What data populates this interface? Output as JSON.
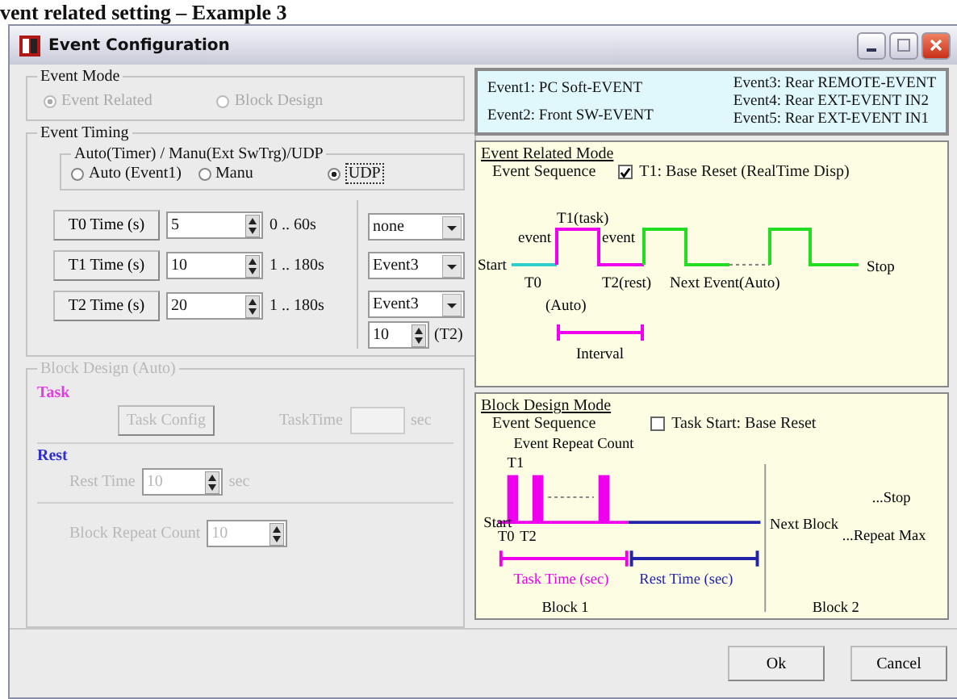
{
  "caption": "vent related setting – Example 3",
  "window": {
    "title": "Event Configuration"
  },
  "event_mode": {
    "label": "Event Mode",
    "options": [
      {
        "label": "Event Related",
        "selected": true,
        "disabled": true
      },
      {
        "label": "Block Design",
        "selected": false,
        "disabled": true
      }
    ]
  },
  "event_timing": {
    "label": "Event Timing",
    "trigger": {
      "label": "Auto(Timer) / Manu(Ext SwTrg)/UDP",
      "options": [
        {
          "label": "Auto (Event1)",
          "selected": false
        },
        {
          "label": "Manu",
          "selected": false
        },
        {
          "label": "UDP",
          "selected": true
        }
      ]
    },
    "times": [
      {
        "button": "T0 Time (s)",
        "value": "5",
        "range": "0 .. 60s",
        "select": "none"
      },
      {
        "button": "T1 Time (s)",
        "value": "10",
        "range": "1 .. 180s",
        "select": "Event3"
      },
      {
        "button": "T2 Time (s)",
        "value": "20",
        "range": "1 .. 180s",
        "select": "Event3"
      }
    ],
    "t2_count": {
      "value": "10",
      "suffix": "(T2)"
    }
  },
  "block_design": {
    "label": "Block Design (Auto)",
    "disabled": true,
    "task_label": "Task",
    "task_config": "Task Config",
    "task_time_label": "TaskTime",
    "task_time_unit": "sec",
    "rest_label": "Rest",
    "rest_time_label": "Rest Time",
    "rest_time_value": "10",
    "rest_time_unit": "sec",
    "repeat_label": "Block Repeat Count",
    "repeat_value": "10"
  },
  "legend": {
    "left": [
      "Event1: PC Soft-EVENT",
      "Event2: Front SW-EVENT"
    ],
    "right": [
      "Event3: Rear REMOTE-EVENT",
      "Event4: Rear EXT-EVENT IN2",
      "Event5: Rear EXT-EVENT IN1"
    ]
  },
  "event_related_mode": {
    "title": "Event Related Mode",
    "sequence_label": "Event Sequence",
    "checkbox": {
      "label": "T1: Base Reset (RealTime Disp)",
      "checked": true
    },
    "labels": {
      "task": "T1(task)",
      "event_in": "event",
      "event_out": "event",
      "start": "Start",
      "t0": "T0",
      "rest": "T2(rest)",
      "next": "Next Event(Auto)",
      "auto": "(Auto)",
      "interval": "Interval",
      "stop": "Stop"
    }
  },
  "block_design_mode": {
    "title": "Block Design Mode",
    "sequence_label": "Event Sequence",
    "checkbox": {
      "label": "Task Start: Base Reset",
      "checked": false
    },
    "labels": {
      "repeat": "Event Repeat Count",
      "t1": "T1",
      "start": "Start",
      "t0": "T0",
      "t2": "T2",
      "task_time": "Task Time (sec)",
      "rest_time": "Rest Time (sec)",
      "block1": "Block 1",
      "next_block": "Next Block",
      "stop": "...Stop",
      "repeat_max": "...Repeat Max",
      "block2": "Block 2"
    }
  },
  "buttons": [
    "Ok",
    "Cancel"
  ]
}
